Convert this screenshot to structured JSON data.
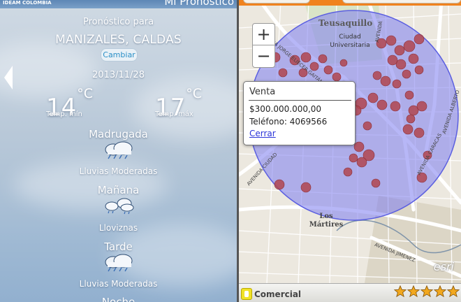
{
  "weather": {
    "brand_text": "IDEAM COLOMBIA",
    "app_title": "Mi Pronóstico",
    "forecast_for": "Pronóstico para",
    "city": "MANIZALES, CALDAS",
    "change_button": "Cambiar",
    "date": "2013/11/28",
    "temp_min": {
      "value": "14",
      "unit": "°C",
      "label": "Temp. mín"
    },
    "temp_max": {
      "value": "17",
      "unit": "°C",
      "label": "Temp. máx"
    },
    "periods": [
      {
        "name": "Madrugada",
        "icon": "rain-cloud-icon",
        "condition": "Lluvias Moderadas"
      },
      {
        "name": "Mañana",
        "icon": "drizzle-cloud-icon",
        "condition": "Lloviznas"
      },
      {
        "name": "Tarde",
        "icon": "rain-cloud-icon",
        "condition": "Lluvias Moderadas"
      },
      {
        "name": "Noche"
      }
    ]
  },
  "map": {
    "labels": {
      "teusaquillo": "Teusaquillo",
      "ciudad_universitaria": "Ciudad Universitaria",
      "los_martires": "Los Mártires",
      "av_jorge_eliecer_gaitan": "AVENIDA JORGE ELIÉCER GAITÁN",
      "avenida_ciudad": "AVENIDA CIUDAD",
      "av_caracas": "AVENIDA CARACAS",
      "av_alberto": "AVENIDA ALBERTO",
      "avenida": "AVENIDA",
      "av_jimenez": "AVENIDA JIMENEZ"
    },
    "zoom_in": "+",
    "zoom_out": "−",
    "popup": {
      "title": "Venta",
      "price": "$300.000.000,00",
      "phone": "Teléfono: 4069566",
      "close": "Cerrar"
    },
    "attribution": "esri",
    "accent_color": "#f0821e",
    "buffer_color": "#7b7cf0",
    "marker_color": "#b0454f"
  },
  "bottom_bar": {
    "category": "Comercial",
    "rating": 5,
    "rating_max": 5
  }
}
